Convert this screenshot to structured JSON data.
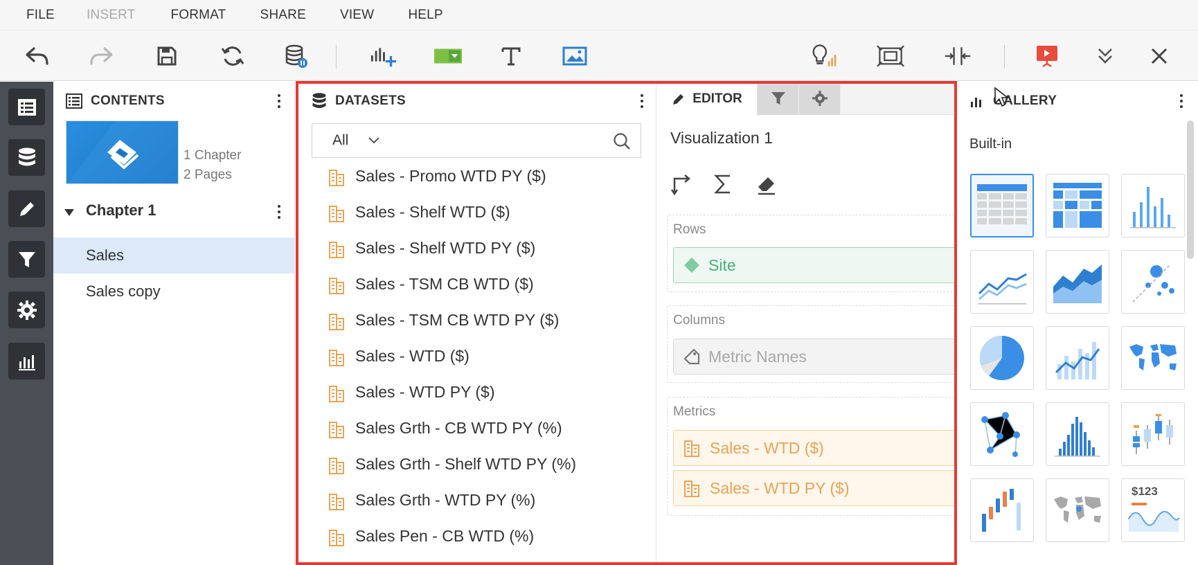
{
  "menu": {
    "items": [
      {
        "label": "FILE",
        "disabled": false
      },
      {
        "label": "INSERT",
        "disabled": true
      },
      {
        "label": "FORMAT",
        "disabled": false
      },
      {
        "label": "SHARE",
        "disabled": false
      },
      {
        "label": "VIEW",
        "disabled": false
      },
      {
        "label": "HELP",
        "disabled": false
      }
    ]
  },
  "toolbar": {
    "icons": [
      "undo-icon",
      "redo-icon",
      "save-icon",
      "refresh-icon",
      "data-pause-icon",
      "add-visualization-icon",
      "filter-selector-icon",
      "text-icon",
      "image-icon",
      "insights-bulb-icon",
      "fit-to-window-icon",
      "resize-icon",
      "presentation-icon",
      "collapse-icon",
      "close-icon"
    ]
  },
  "contents": {
    "title": "CONTENTS",
    "chapter_count": "1 Chapter",
    "page_count": "2 Pages",
    "chapter_label": "Chapter 1",
    "pages": [
      {
        "label": "Sales",
        "selected": true
      },
      {
        "label": "Sales copy",
        "selected": false
      }
    ]
  },
  "datasets": {
    "title": "DATASETS",
    "filter_value": "All",
    "items": [
      "Sales - Promo WTD PY ($)",
      "Sales - Shelf WTD ($)",
      "Sales - Shelf WTD PY ($)",
      "Sales - TSM CB WTD ($)",
      "Sales - TSM CB WTD PY ($)",
      "Sales - WTD ($)",
      "Sales - WTD PY ($)",
      "Sales Grth - CB WTD PY (%)",
      "Sales Grth - Shelf WTD PY (%)",
      "Sales Grth - WTD PY (%)",
      "Sales Pen - CB WTD (%)"
    ]
  },
  "editor": {
    "tab_label": "EDITOR",
    "viz_title": "Visualization 1",
    "rows_label": "Rows",
    "rows_chip": "Site",
    "columns_label": "Columns",
    "columns_chip": "Metric Names",
    "metrics_label": "Metrics",
    "metrics_chips": [
      "Sales - WTD ($)",
      "Sales - WTD PY ($)"
    ]
  },
  "gallery": {
    "title": "GALLERY",
    "section": "Built-in",
    "price_label": "$123",
    "tiles": [
      "grid",
      "heat-map",
      "vertical-bar",
      "line",
      "area",
      "bubble",
      "pie",
      "combo",
      "map",
      "network",
      "histogram",
      "box-plot",
      "waterfall",
      "geo-map",
      "kpi"
    ]
  },
  "colors": {
    "accent": "#3a8ee6",
    "highlight": "#e53935",
    "metric": "#e9a354",
    "attribute": "#48b07a"
  }
}
